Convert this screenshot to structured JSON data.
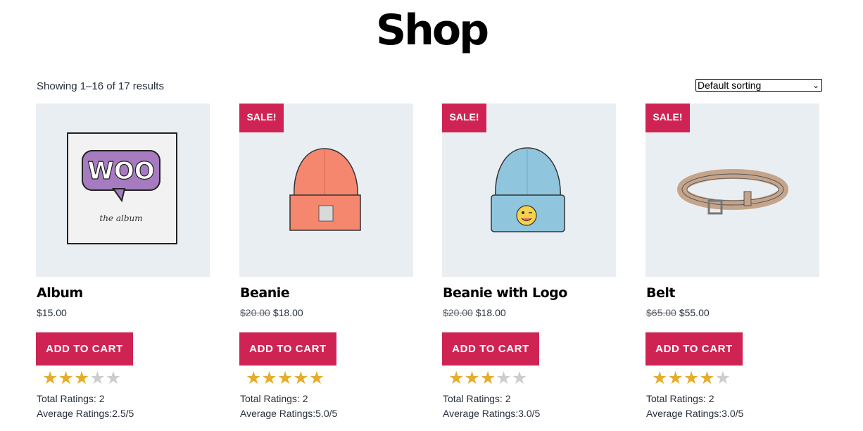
{
  "page": {
    "title": "Shop",
    "result_count": "Showing 1–16 of 17 results",
    "sorting": {
      "selected": "Default sorting"
    }
  },
  "products": [
    {
      "name": "Album",
      "sale": false,
      "sale_label": "",
      "regular_price": "$15.00",
      "sale_price": "",
      "cta": "ADD TO CART",
      "stars_filled": 3,
      "stars_total": 5,
      "total_ratings": "Total Ratings: 2",
      "average_ratings": "Average Ratings:2.5/5",
      "album_text": {
        "logo": "WOO",
        "caption": "the album"
      }
    },
    {
      "name": "Beanie",
      "sale": true,
      "sale_label": "SALE!",
      "regular_price": "$20.00",
      "sale_price": "$18.00",
      "cta": "ADD TO CART",
      "stars_filled": 5,
      "stars_total": 5,
      "total_ratings": "Total Ratings: 2",
      "average_ratings": "Average Ratings:5.0/5"
    },
    {
      "name": "Beanie with Logo",
      "sale": true,
      "sale_label": "SALE!",
      "regular_price": "$20.00",
      "sale_price": "$18.00",
      "cta": "ADD TO CART",
      "stars_filled": 3,
      "stars_total": 5,
      "total_ratings": "Total Ratings: 2",
      "average_ratings": "Average Ratings:3.0/5"
    },
    {
      "name": "Belt",
      "sale": true,
      "sale_label": "SALE!",
      "regular_price": "$65.00",
      "sale_price": "$55.00",
      "cta": "ADD TO CART",
      "stars_filled": 4,
      "stars_total": 5,
      "total_ratings": "Total Ratings: 2",
      "average_ratings": "Average Ratings:3.0/5"
    }
  ],
  "colors": {
    "accent": "#cf2453",
    "thumb_bg": "#e9eef2",
    "star_on": "#e4ad2c",
    "star_off": "#cdcdcd"
  }
}
